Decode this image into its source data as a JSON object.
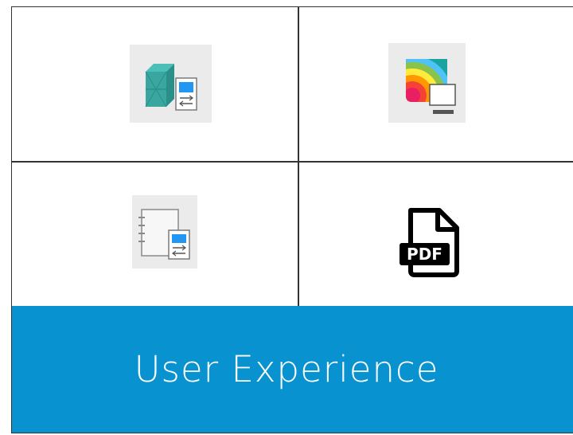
{
  "tiles": [
    {
      "name": "structure-settings-icon"
    },
    {
      "name": "heatmap-display-icon"
    },
    {
      "name": "notebook-settings-icon"
    },
    {
      "name": "pdf-file-icon",
      "label": "PDF"
    }
  ],
  "banner": {
    "title": "User Experience"
  },
  "colors": {
    "banner": "#0892d0",
    "teal": "#3aa6a0",
    "accent_blue": "#2196f3",
    "grid_line": "#333333"
  }
}
